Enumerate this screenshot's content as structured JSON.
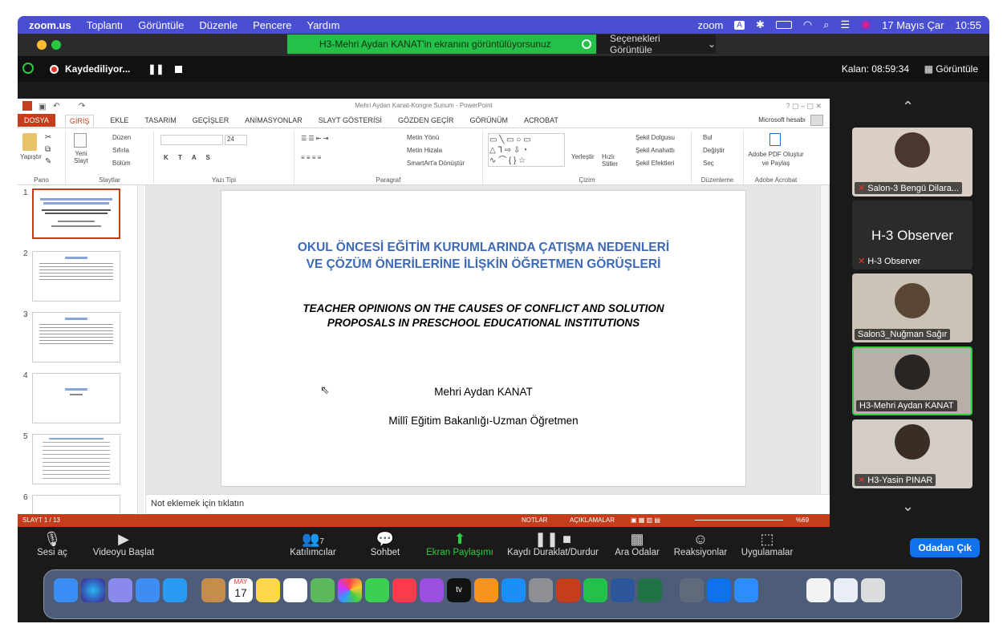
{
  "mac": {
    "app_name": "zoom.us",
    "menus": [
      "Toplantı",
      "Görüntüle",
      "Düzenle",
      "Pencere",
      "Yardım"
    ],
    "status": {
      "zoom": "zoom",
      "kbd": "A",
      "date": "17 Mayıs Çar",
      "time": "10:55"
    }
  },
  "share": {
    "banner": "H3-Mehri Aydan KANAT'in ekranını görüntülüyorsunuz",
    "options": "Seçenekleri Görüntüle"
  },
  "recording": {
    "label": "Kaydediliyor...",
    "remaining": "Kalan: 08:59:34",
    "view": "Görüntüle"
  },
  "ppt": {
    "title": "Mehri Aydan Kanat-Kongre Sunum - PowerPoint",
    "tabs": [
      "DOSYA",
      "GİRİŞ",
      "EKLE",
      "TASARIM",
      "GEÇİŞLER",
      "ANİMASYONLAR",
      "SLAYT GÖSTERİSİ",
      "GÖZDEN GEÇİR",
      "GÖRÜNÜM",
      "ACROBAT"
    ],
    "account": "Microsoft hesabı",
    "ribbon": {
      "paste": "Yapıştır",
      "new_slide": "Yeni Slayt",
      "layout": "Düzen",
      "reset": "Sıfırla",
      "section": "Bölüm",
      "groups": [
        "Pano",
        "Slaytlar",
        "Yazı Tipi",
        "Paragraf",
        "Çizim",
        "Düzenleme",
        "Adobe Acrobat"
      ],
      "font_size": "24",
      "text_dir": "Metin Yönü",
      "align_text": "Metin Hizala",
      "smartart": "SmartArt'a Dönüştür",
      "arrange": "Yerleştir",
      "quick_styles": "Hızlı Stiller",
      "fill": "Şekil Dolgusu",
      "outline": "Şekil Anahattı",
      "effects": "Şekil Efektleri",
      "find": "Bul",
      "replace": "Değiştir",
      "select": "Seç",
      "adobe": "Adobe PDF Oluştur ve Paylaş"
    },
    "thumb_numbers": [
      "1",
      "2",
      "3",
      "4",
      "5",
      "6"
    ],
    "slide": {
      "title_line1": "OKUL ÖNCESİ EĞİTİM KURUMLARINDA ÇATIŞMA NEDENLERİ",
      "title_line2": "VE ÇÖZÜM ÖNERİLERİNE İLİŞKİN ÖĞRETMEN GÖRÜŞLERİ",
      "sub_line1": "TEACHER OPINIONS ON THE CAUSES OF CONFLICT AND SOLUTION",
      "sub_line2": "PROPOSALS IN PRESCHOOL EDUCATIONAL INSTITUTIONS",
      "author": "Mehri Aydan KANAT",
      "institution": "Millî Eğitim Bakanlığı-Uzman Öğretmen"
    },
    "notes_placeholder": "Not eklemek için tıklatın",
    "status": {
      "slide": "SLAYT 1 / 13",
      "notes": "NOTLAR",
      "comments": "AÇIKLAMALAR",
      "zoom": "%69"
    }
  },
  "participants": [
    {
      "name": "Salon-3 Bengü Dilara..."
    },
    {
      "big": "H-3 Observer",
      "name": "H-3 Observer"
    },
    {
      "name": "Salon3_Nuğman Sağır"
    },
    {
      "name": "H3-Mehri Aydan KANAT"
    },
    {
      "name": "H3-Yasin PINAR"
    }
  ],
  "toolbar": {
    "mute": "Sesi aç",
    "video": "Videoyu Başlat",
    "participants": "Katılımcılar",
    "participants_count": "7",
    "chat": "Sohbet",
    "share": "Ekran Paylaşımı",
    "record": "Kaydı Duraklat/Durdur",
    "breakout": "Ara Odalar",
    "reactions": "Reaksiyonlar",
    "apps": "Uygulamalar",
    "leave": "Odadan Çık"
  },
  "dock": {
    "calendar_month": "MAY",
    "calendar_day": "17",
    "tv": "tv"
  },
  "colors": {
    "menubar": "#4a4fd1",
    "share_green": "#23c04a",
    "ppt_red": "#c43e1c",
    "slide_title": "#3e69b5",
    "zoom_blue": "#0e72ed"
  }
}
